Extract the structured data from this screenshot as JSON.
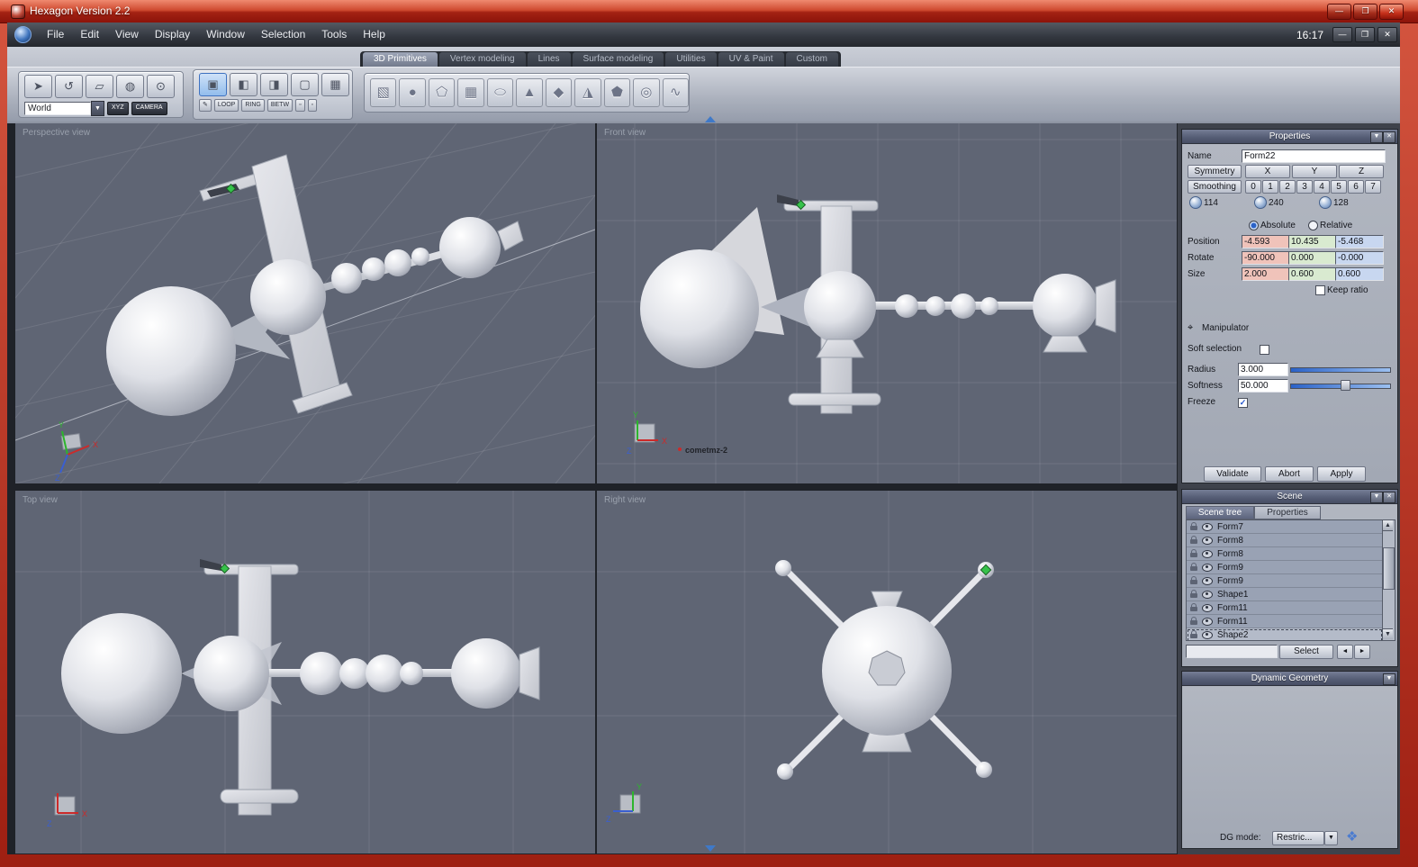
{
  "window": {
    "title": "Hexagon Version 2.2",
    "clock": "16:17",
    "minimize_glyph": "—",
    "maximize_glyph": "❐",
    "close_glyph": "✕"
  },
  "menu": {
    "items": [
      "File",
      "Edit",
      "View",
      "Display",
      "Window",
      "Selection",
      "Tools",
      "Help"
    ]
  },
  "tabs": {
    "items": [
      "3D Primitives",
      "Vertex modeling",
      "Lines",
      "Surface modeling",
      "Utilities",
      "UV & Paint",
      "Custom"
    ],
    "active": "3D Primitives"
  },
  "toolbar": {
    "world_selector": "World",
    "xyz": "XYZ",
    "camera": "CAMERA",
    "loop": "LOOP",
    "ring": "RING",
    "betw": "BETW"
  },
  "viewports": {
    "perspective_label": "Perspective view",
    "front_label": "Front view",
    "top_label": "Top view",
    "right_label": "Right view",
    "front_object_label": "cometmz-2",
    "axis": {
      "x": "X",
      "y": "Y",
      "z": "Z"
    }
  },
  "properties": {
    "title": "Properties",
    "name_label": "Name",
    "name_value": "Form22",
    "symmetry_label": "Symmetry",
    "axis_x": "X",
    "axis_y": "Y",
    "axis_z": "Z",
    "smoothing_label": "Smoothing",
    "smoothing_levels": [
      "0",
      "1",
      "2",
      "3",
      "4",
      "5",
      "6",
      "7"
    ],
    "counts": {
      "points": "114",
      "edges": "240",
      "faces": "128"
    },
    "absolute_label": "Absolute",
    "relative_label": "Relative",
    "position_label": "Position",
    "position": {
      "x": "-4.593",
      "y": "10.435",
      "z": "-5.468"
    },
    "rotate_label": "Rotate",
    "rotate": {
      "x": "-90.000",
      "y": "0.000",
      "z": "-0.000"
    },
    "size_label": "Size",
    "size": {
      "x": "2.000",
      "y": "0.600",
      "z": "0.600"
    },
    "keep_ratio_label": "Keep ratio",
    "manipulator_label": "Manipulator",
    "soft_selection_label": "Soft selection",
    "radius_label": "Radius",
    "radius_value": "3.000",
    "softness_label": "Softness",
    "softness_value": "50.000",
    "freeze_label": "Freeze",
    "freeze_checked": "✓",
    "validate_label": "Validate",
    "abort_label": "Abort",
    "apply_label": "Apply"
  },
  "scene": {
    "title": "Scene",
    "tab_tree": "Scene tree",
    "tab_properties": "Properties",
    "items": [
      "Form7",
      "Form8",
      "Form8",
      "Form9",
      "Form9",
      "Shape1",
      "Form11",
      "Form11",
      "Shape2"
    ],
    "select_label": "Select"
  },
  "dynamic_geometry": {
    "title": "Dynamic Geometry",
    "dg_mode_label": "DG mode:",
    "dg_mode_value": "Restric..."
  }
}
